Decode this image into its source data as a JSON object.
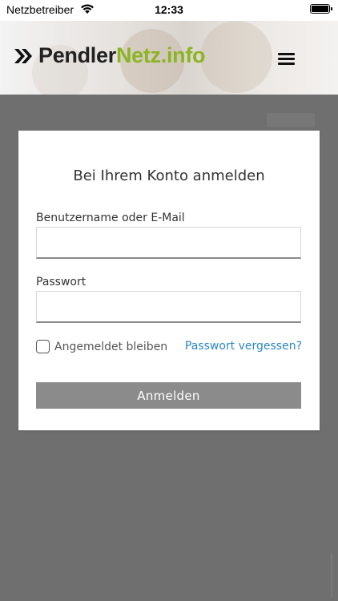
{
  "status_bar": {
    "carrier": "Netzbetreiber",
    "time": "12:33",
    "icons": [
      "wifi-icon",
      "battery-icon"
    ]
  },
  "header": {
    "logo_part1": "Pendler",
    "logo_part2": "Netz.info",
    "logo_icon": "double-chevron-icon",
    "menu_icon": "hamburger-menu-icon",
    "colors": {
      "brand_green": "#8cb423",
      "brand_dark": "#222222"
    }
  },
  "login": {
    "title": "Bei Ihrem Konto anmelden",
    "username_label": "Benutzername oder E-Mail",
    "username_value": "",
    "password_label": "Passwort",
    "password_value": "",
    "remember_label": "Angemeldet bleiben",
    "remember_checked": false,
    "forgot_link": "Passwort vergessen?",
    "submit_label": "Anmelden",
    "colors": {
      "link": "#2b86c4",
      "button": "#8b8b8b",
      "page_background": "#6f6f6f"
    }
  }
}
